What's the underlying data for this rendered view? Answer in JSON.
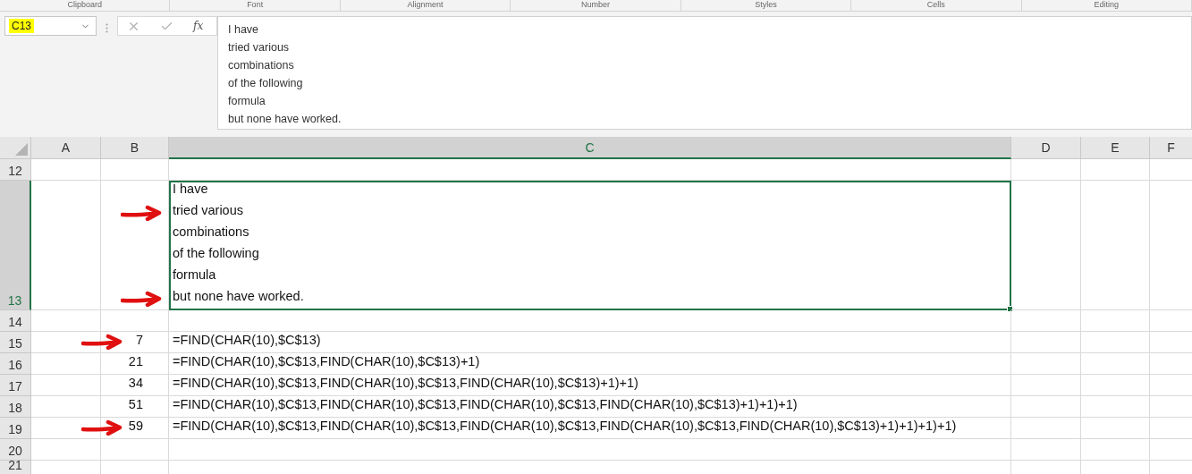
{
  "ribbon_groups": [
    "Clipboard",
    "Font",
    "Alignment",
    "Number",
    "Styles",
    "Cells",
    "Editing"
  ],
  "name_box": {
    "value": "C13",
    "highlighted": true
  },
  "formula_bar": {
    "function_label": "fx",
    "lines": [
      "I have",
      "tried various",
      "combinations",
      "of the following",
      "formula",
      "but none have worked."
    ]
  },
  "columns": [
    {
      "label": "A",
      "selected": false
    },
    {
      "label": "B",
      "selected": false
    },
    {
      "label": "C",
      "selected": true
    },
    {
      "label": "D",
      "selected": false
    },
    {
      "label": "E",
      "selected": false
    },
    {
      "label": "F",
      "selected": false
    }
  ],
  "rows": [
    {
      "label": "12",
      "selected": false
    },
    {
      "label": "13",
      "selected": true,
      "c_lines": [
        {
          "text": "I have",
          "arrow": false
        },
        {
          "text": "tried various",
          "arrow": true
        },
        {
          "text": "combinations",
          "arrow": false
        },
        {
          "text": "of the following",
          "arrow": false
        },
        {
          "text": "formula",
          "arrow": false
        },
        {
          "text": "but none have worked.",
          "arrow": true
        }
      ]
    },
    {
      "label": "14",
      "selected": false
    },
    {
      "label": "15",
      "selected": false,
      "b": "7",
      "arrow": true,
      "c": "=FIND(CHAR(10),$C$13)"
    },
    {
      "label": "16",
      "selected": false,
      "b": "21",
      "arrow": false,
      "c": "=FIND(CHAR(10),$C$13,FIND(CHAR(10),$C$13)+1)"
    },
    {
      "label": "17",
      "selected": false,
      "b": "34",
      "arrow": false,
      "c": "=FIND(CHAR(10),$C$13,FIND(CHAR(10),$C$13,FIND(CHAR(10),$C$13)+1)+1)"
    },
    {
      "label": "18",
      "selected": false,
      "b": "51",
      "arrow": false,
      "c": "=FIND(CHAR(10),$C$13,FIND(CHAR(10),$C$13,FIND(CHAR(10),$C$13,FIND(CHAR(10),$C$13)+1)+1)+1)"
    },
    {
      "label": "19",
      "selected": false,
      "b": "59",
      "arrow": true,
      "c": "=FIND(CHAR(10),$C$13,FIND(CHAR(10),$C$13,FIND(CHAR(10),$C$13,FIND(CHAR(10),$C$13,FIND(CHAR(10),$C$13)+1)+1)+1)+1)"
    },
    {
      "label": "20",
      "selected": false
    },
    {
      "label": "21",
      "selected": false
    }
  ]
}
